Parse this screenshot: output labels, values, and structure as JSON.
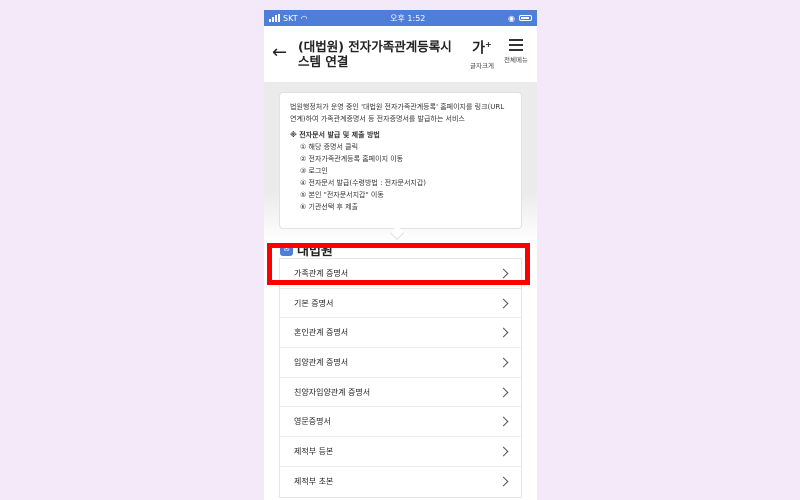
{
  "status_bar": {
    "carrier": "SKT",
    "time": "오후 1:52"
  },
  "header": {
    "back_icon": "arrow-left-icon",
    "title": "(대법원) 전자가족관계등록시스템 연결",
    "font_size_glyph": "가",
    "font_size_label": "글자크게",
    "menu_label": "전체메뉴"
  },
  "info_box": {
    "intro": "법원행정처가 운영 중인 '대법원 전자가족관계등록' 홈페이지를 링크(URL 연계)하여 가족관계증명서 등 전자증명서를 발급하는 서비스",
    "steps_title": "※ 전자문서 발급 및 제출 방법",
    "steps": [
      "① 해당 증명서 클릭",
      "② 전자가족관계등록 홈페이지 이동",
      "③ 로그인",
      "④ 전자문서 발급(수령방법 : 전자문서지갑)",
      "⑤ 본인 \"전자문서지갑\" 이동",
      "⑥ 기관선택 후 제출"
    ]
  },
  "section": {
    "title": "대법원"
  },
  "documents": [
    "가족관계 증명서",
    "기본 증명서",
    "혼인관계 증명서",
    "입양관계 증명서",
    "친양자입양관계 증명서",
    "영문증명서",
    "제적부 등본",
    "제적부 초본"
  ],
  "highlighted_item": "가족관계 증명서",
  "colors": {
    "accent": "#4f7ed9",
    "highlight": "#ff0000",
    "background": "#f3e9f8"
  }
}
